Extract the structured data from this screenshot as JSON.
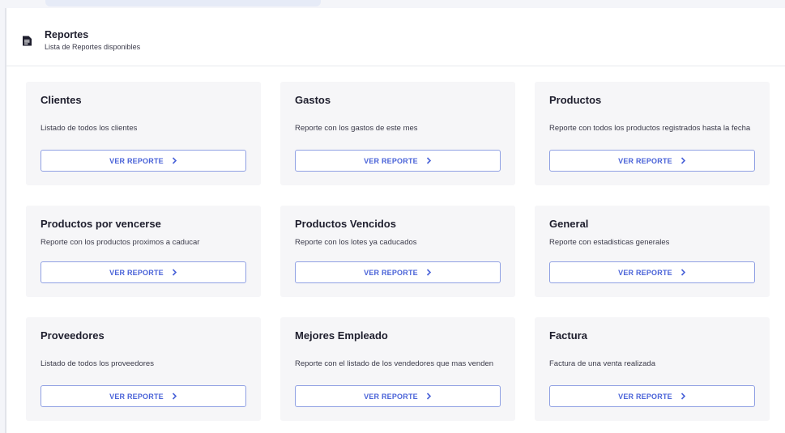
{
  "header": {
    "title": "Reportes",
    "subtitle": "Lista de Reportes disponibles"
  },
  "cards": [
    {
      "title": "Clientes",
      "description": "Listado de todos los clientes",
      "button": "VER REPORTE"
    },
    {
      "title": "Gastos",
      "description": "Reporte con los gastos de este mes",
      "button": "VER REPORTE"
    },
    {
      "title": "Productos",
      "description": "Reporte con todos los productos registrados hasta la fecha",
      "button": "VER REPORTE"
    },
    {
      "title": "Productos por vencerse",
      "description": "Reporte con los productos proximos a caducar",
      "button": "VER REPORTE"
    },
    {
      "title": "Productos Vencidos",
      "description": "Reporte con los lotes ya caducados",
      "button": "VER REPORTE"
    },
    {
      "title": "General",
      "description": "Reporte con estadisticas generales",
      "button": "VER REPORTE"
    },
    {
      "title": "Proveedores",
      "description": "Listado de todos los proveedores",
      "button": "VER REPORTE"
    },
    {
      "title": "Mejores Empleado",
      "description": "Reporte con el listado de los vendedores que mas venden",
      "button": "VER REPORTE"
    },
    {
      "title": "Factura",
      "description": "Factura de una venta realizada",
      "button": "VER REPORTE"
    }
  ],
  "colors": {
    "accent": "#4a63d8",
    "button_border": "#8fa0e3",
    "card_bg": "#f6f6f8"
  },
  "icons": {
    "header": "document-report-icon",
    "button": "chevron-right-icon"
  }
}
